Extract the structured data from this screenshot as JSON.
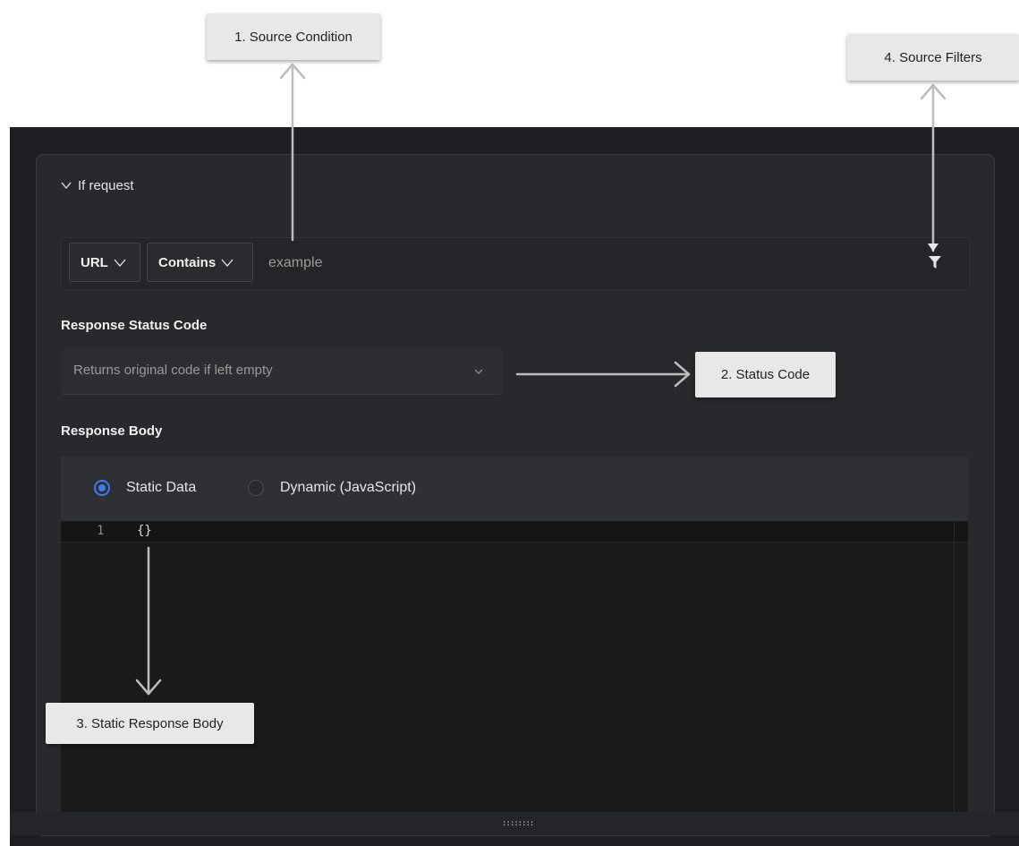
{
  "rule": {
    "header_title": "If request",
    "condition": {
      "source_key": "URL",
      "operator": "Contains",
      "value": "example"
    },
    "status_code": {
      "label": "Response Status Code",
      "placeholder": "Returns original code if left empty"
    },
    "response_body": {
      "label": "Response Body",
      "options": [
        "Static Data",
        "Dynamic (JavaScript)"
      ],
      "selected": "Static Data",
      "editor": {
        "line_number": "1",
        "code": "{}"
      }
    }
  },
  "drag_handle": "::::::::",
  "callouts": {
    "source_condition": "1. Source Condition",
    "status_code": "2. Status Code",
    "static_response_body": "3. Static Response Body",
    "source_filters": "4. Source Filters"
  },
  "colors": {
    "accent": "#3d7bf2",
    "panel": "#1d1e21",
    "card": "#28292c"
  },
  "icons": [
    "chevron-down-icon",
    "filter-icon"
  ]
}
